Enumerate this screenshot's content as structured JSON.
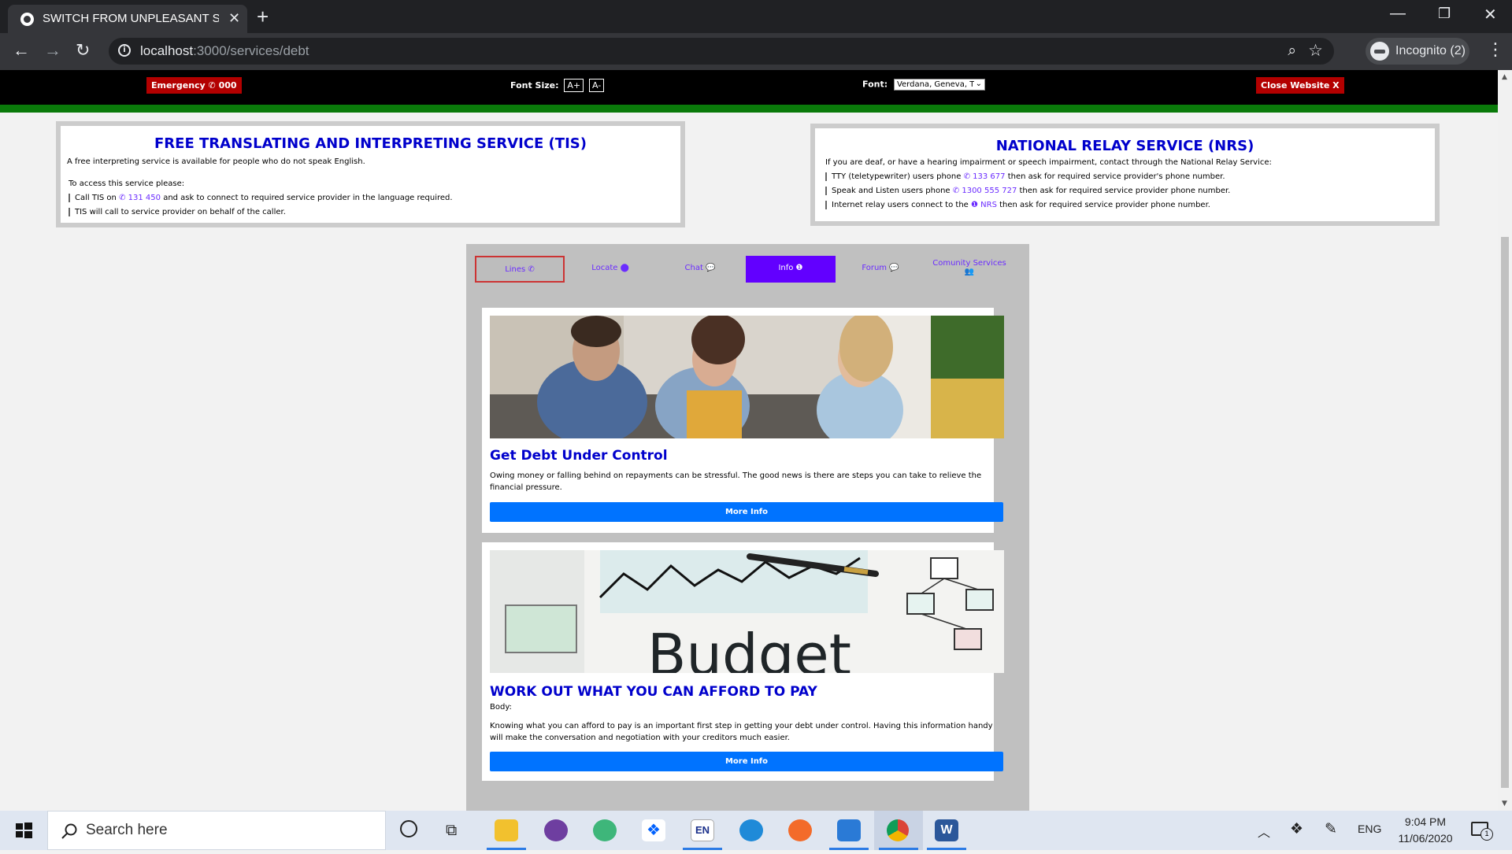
{
  "browser": {
    "tab_title": "SWITCH FROM UNPLEASANT SC",
    "url_host": "localhost",
    "url_path": ":3000/services/debt",
    "profile_label": "Incognito (2)"
  },
  "topbar": {
    "emergency_label": "Emergency ✆ 000",
    "font_size_label": "Font Size:",
    "font_increase": "A+",
    "font_decrease": "A-",
    "font_label": "Font:",
    "font_value": "Verdana, Geneva, T",
    "close_label": "Close Website X"
  },
  "tis": {
    "title": "FREE TRANSLATING AND INTERPRETING SERVICE (TIS)",
    "intro": "A free interpreting service is available for people who do not speak English.",
    "access": "To access this service please:",
    "step1_pre": "Call TIS on",
    "step1_phone": "✆ 131 450",
    "step1_post": "and ask to connect to required service provider in the language required.",
    "step2": "TIS will call to service provider on behalf of the caller."
  },
  "nrs": {
    "title": "NATIONAL RELAY SERVICE (NRS)",
    "intro": "If you are deaf, or have a hearing impairment or speech impairment, contact through the National Relay Service:",
    "tty_pre": "TTY (teletypewriter) users phone",
    "tty_phone": "✆ 133 677",
    "tty_post": "then ask for required service provider's phone number.",
    "speak_pre": "Speak and Listen users phone",
    "speak_phone": "✆ 1300 555 727",
    "speak_post": "then ask for required service provider phone number.",
    "relay_pre": "Internet relay users connect to the",
    "relay_link": "❶ NRS",
    "relay_post": "then ask for required service provider phone number."
  },
  "tabs": [
    {
      "label": "Lines ✆",
      "state": "outlined"
    },
    {
      "label": "Locate ⬤",
      "state": "normal"
    },
    {
      "label": "Chat 💬",
      "state": "normal"
    },
    {
      "label": "Info ❶",
      "state": "active"
    },
    {
      "label": "Forum 💬",
      "state": "normal"
    },
    {
      "label": "Comunity Services",
      "state": "normal"
    }
  ],
  "cards": [
    {
      "title": "Get Debt Under Control",
      "body": "Owing money or falling behind on repayments can be stressful. The good news is there are steps you can take to relieve the financial pressure.",
      "button": "More Info"
    },
    {
      "title": "WORK OUT WHAT YOU CAN AFFORD TO PAY",
      "label": "Body:",
      "body": "Knowing what you can afford to pay is an important first step in getting your debt under control. Having this information handy will make the conversation and negotiation with your creditors much easier.",
      "image_text": "Budget",
      "button": "More Info"
    }
  ],
  "taskbar": {
    "search_placeholder": "Search here",
    "lang": "ENG",
    "time": "9:04 PM",
    "date": "11/06/2020",
    "notif_count": "1",
    "en_label": "EN"
  },
  "colors": {
    "accent_purple": "#6200ff",
    "heading_blue": "#0000cc",
    "button_blue": "#0073ff",
    "danger_red": "#b30000",
    "green_bar": "#0a7a0a"
  }
}
